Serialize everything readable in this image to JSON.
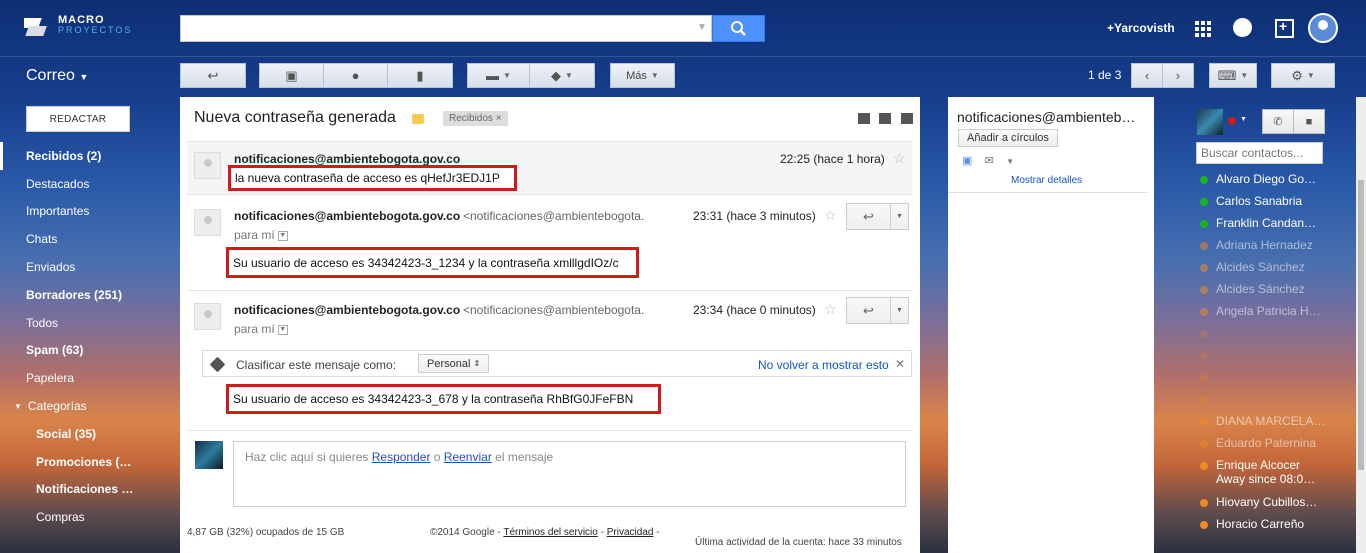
{
  "brand": {
    "name": "MACRO",
    "sub": "PROYECTOS"
  },
  "search": {
    "value": "",
    "placeholder": ""
  },
  "header": {
    "user": "+Yarcovisth"
  },
  "mail_label": "Correo",
  "toolbar": {
    "more_label": "Más"
  },
  "pager": {
    "text": "1 de 3"
  },
  "compose": {
    "label": "REDACTAR"
  },
  "nav": {
    "items": [
      {
        "label": "Recibidos (2)"
      },
      {
        "label": "Destacados"
      },
      {
        "label": "Importantes"
      },
      {
        "label": "Chats"
      },
      {
        "label": "Enviados"
      },
      {
        "label": "Borradores (251)"
      },
      {
        "label": "Todos"
      },
      {
        "label": "Spam (63)"
      },
      {
        "label": "Papelera"
      },
      {
        "label": "Categorías"
      },
      {
        "label": "Social (35)"
      },
      {
        "label": "Promociones (…"
      },
      {
        "label": "Notificaciones …"
      },
      {
        "label": "Compras"
      }
    ]
  },
  "thread": {
    "subject": "Nueva contraseña generada",
    "label_chip": "Recibidos",
    "messages": [
      {
        "sender": "notificaciones@ambientebogota.gov.co",
        "time": "22:25 (hace 1 hora)",
        "snippet": "la nueva contraseña de acceso es qHefJr3EDJ1P"
      },
      {
        "sender": "notificaciones@ambientebogota.gov.co",
        "email": "<notificaciones@ambientebogota.",
        "time": "23:31 (hace 3 minutos)",
        "to": "para mí",
        "body": "Su usuario de acceso es 34342423-3_1234 y la contraseña xmlllgdIOz/c"
      },
      {
        "sender": "notificaciones@ambientebogota.gov.co",
        "email": "<notificaciones@ambientebogota.",
        "time": "23:34 (hace 0 minutos)",
        "to": "para mí",
        "body": "Su usuario de acceso es 34342423-3_678 y la contraseña RhBfG0JFeFBN"
      }
    ],
    "classify": {
      "label": "Clasificar este mensaje como:",
      "value": "Personal",
      "dismiss": "No volver a mostrar esto"
    },
    "reply": {
      "prefix": "Haz clic aquí si quieres ",
      "reply_link": "Responder",
      "mid": " o ",
      "forward_link": "Reenviar",
      "suffix": " el mensaje"
    }
  },
  "footer": {
    "storage": "4,87 GB (32%) ocupados de 15 GB",
    "copyright": "©2014 Google - ",
    "terms": "Términos del servicio",
    "dash": " - ",
    "privacy": "Privacidad",
    "activity": "Última actividad de la cuenta: hace 33 minutos"
  },
  "contact_card": {
    "name": "notificaciones@ambienteb…",
    "circles": "Añadir a círculos",
    "details": "Mostrar detalles"
  },
  "chat": {
    "search_placeholder": "Buscar contactos...",
    "contacts": [
      {
        "name": "Alvaro Diego Go…",
        "status": "#1bb31b"
      },
      {
        "name": "Carlos Sanabria",
        "status": "#1bb31b"
      },
      {
        "name": "Franklin Candan…",
        "status": "#1bb31b"
      },
      {
        "name": "Adriana Hernadez",
        "status": "#f08a24"
      },
      {
        "name": "Alcides Sánchez",
        "status": "#f08a24"
      },
      {
        "name": "Alcides Sánchez",
        "status": "#f08a24"
      },
      {
        "name": "Angela Patricia H…",
        "status": "#f08a24"
      },
      {
        "name": "DIANA MARCELA…",
        "status": "#f08a24"
      },
      {
        "name": "Eduardo Paternina",
        "status": "#f08a24"
      },
      {
        "name": "Enrique Alcocer",
        "sub": "Away since 08:0…",
        "status": "#f08a24"
      },
      {
        "name": "Hiovany Cubillos…",
        "status": "#f08a24"
      },
      {
        "name": "Horacio Carreño",
        "status": "#f08a24"
      }
    ]
  },
  "colors": {
    "accent": "#4d90fe",
    "highlight": "#d01b1b",
    "link": "#1155cc"
  }
}
